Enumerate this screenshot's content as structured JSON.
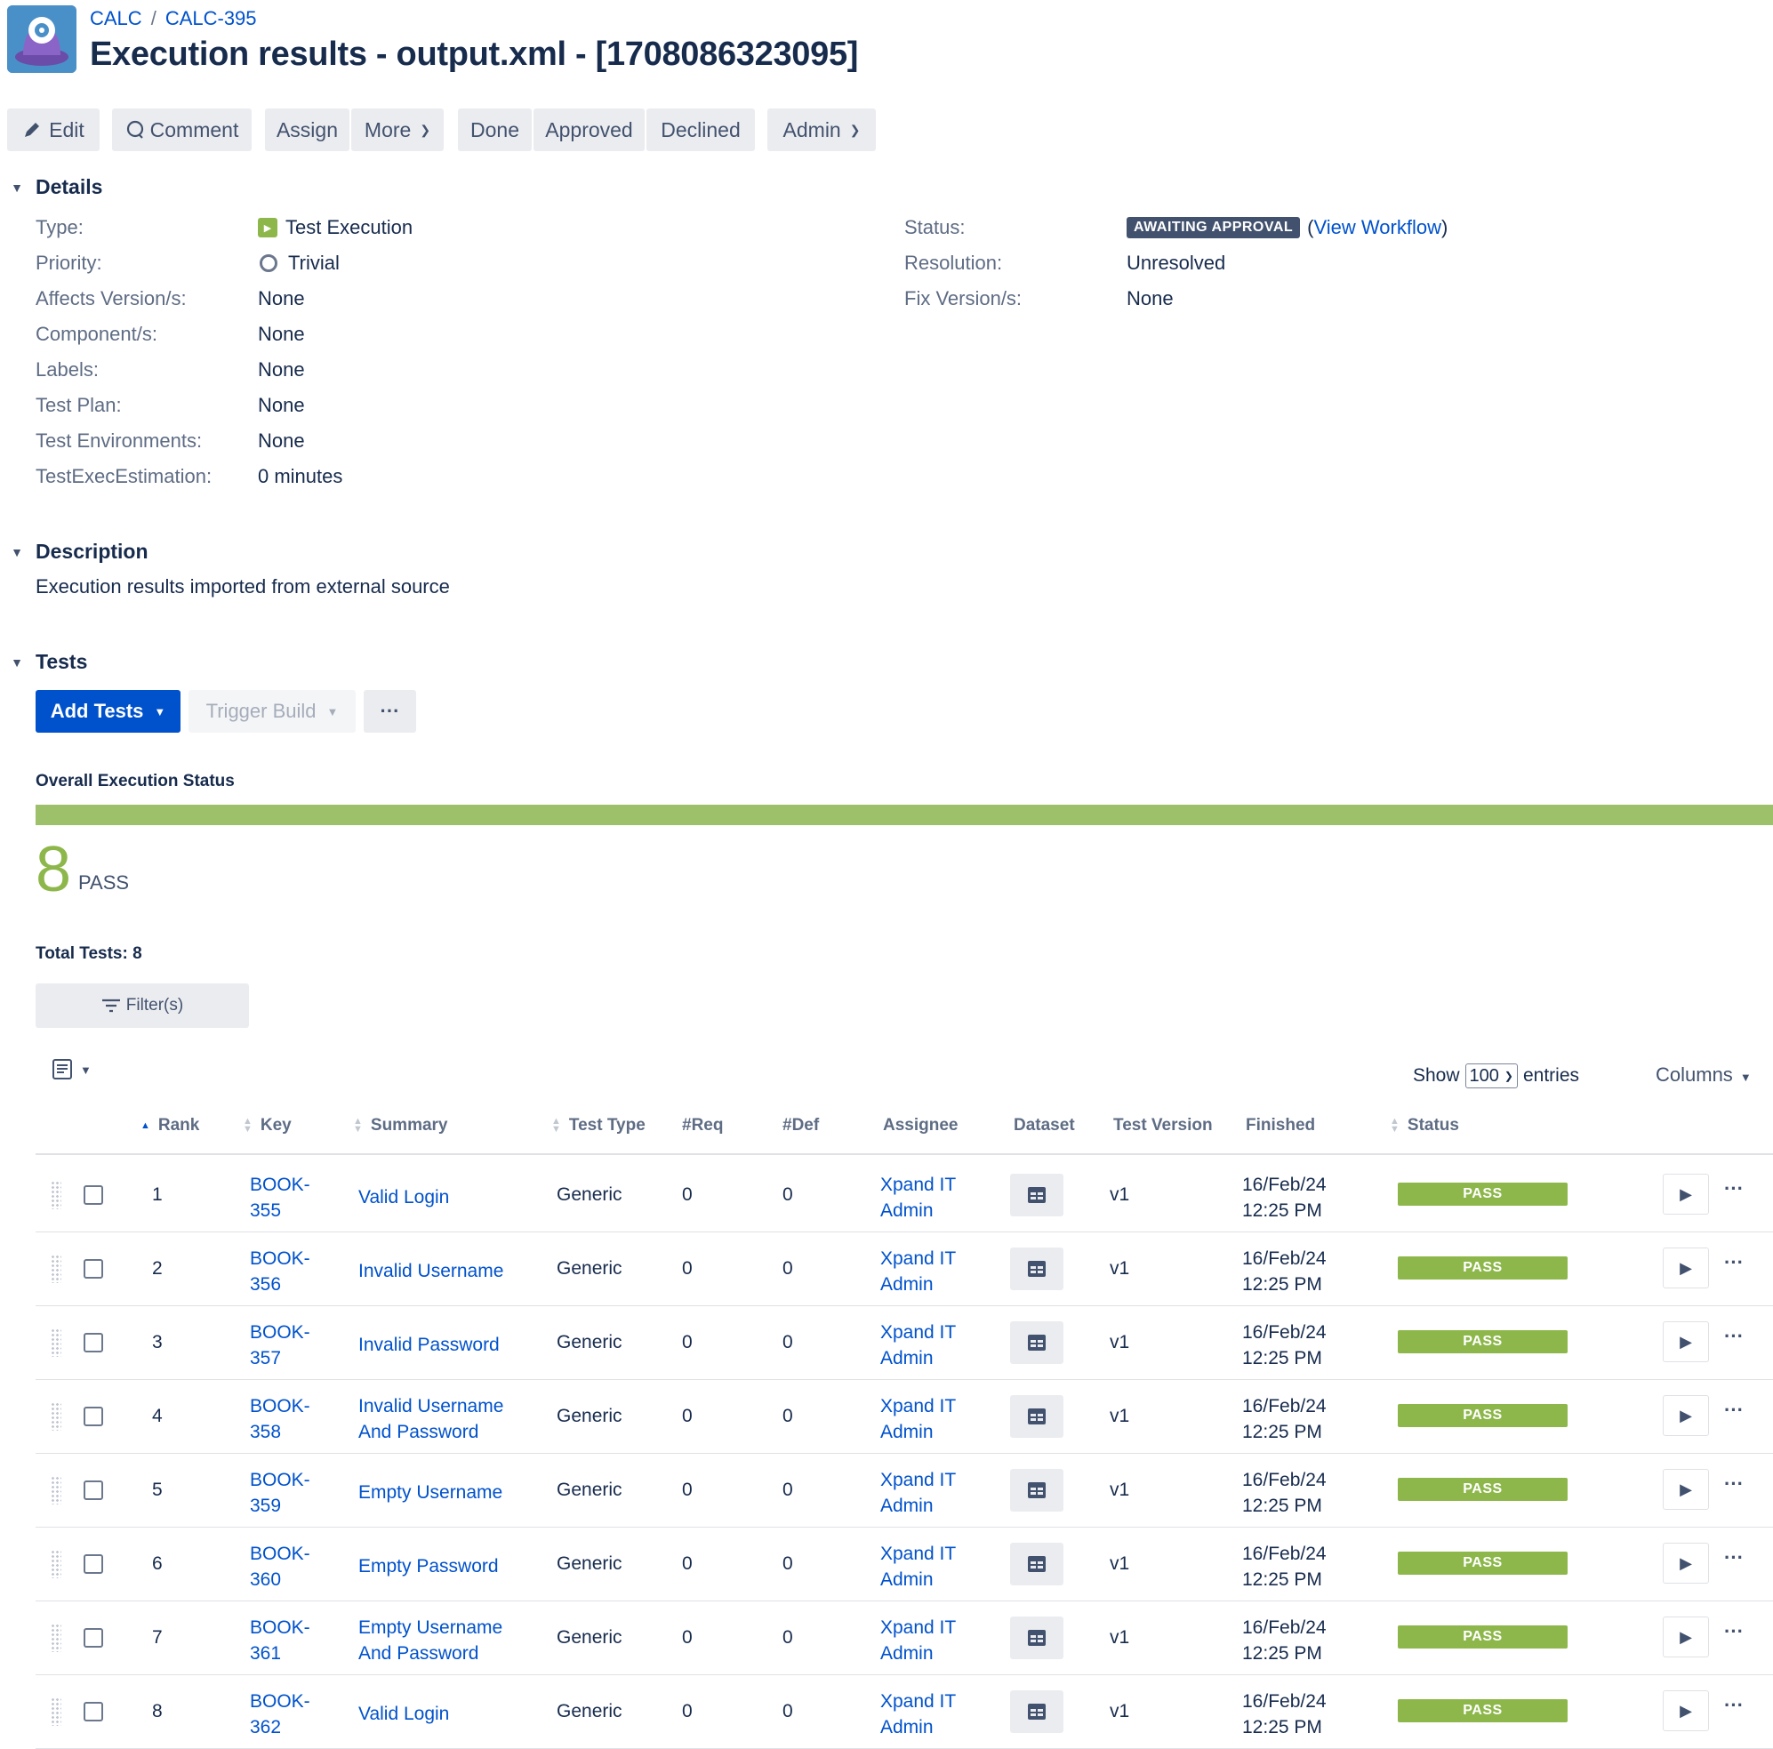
{
  "breadcrumb": {
    "project": "CALC",
    "issue_key": "CALC-395"
  },
  "title": "Execution results - output.xml - [1708086323095]",
  "toolbar": {
    "edit": "Edit",
    "comment": "Comment",
    "assign": "Assign",
    "more": "More",
    "done": "Done",
    "approved": "Approved",
    "declined": "Declined",
    "admin": "Admin"
  },
  "details": {
    "heading": "Details",
    "type_label": "Type:",
    "type_value": "Test Execution",
    "priority_label": "Priority:",
    "priority_value": "Trivial",
    "affects_label": "Affects Version/s:",
    "affects_value": "None",
    "components_label": "Component/s:",
    "components_value": "None",
    "labels_label": "Labels:",
    "labels_value": "None",
    "testplan_label": "Test Plan:",
    "testplan_value": "None",
    "testenv_label": "Test Environments:",
    "testenv_value": "None",
    "estimation_label": "TestExecEstimation:",
    "estimation_value": "0 minutes",
    "status_label": "Status:",
    "status_value": "AWAITING APPROVAL",
    "view_workflow": "View Workflow",
    "resolution_label": "Resolution:",
    "resolution_value": "Unresolved",
    "fix_label": "Fix Version/s:",
    "fix_value": "None"
  },
  "description": {
    "heading": "Description",
    "text": "Execution results imported from external source"
  },
  "tests": {
    "heading": "Tests",
    "add_tests": "Add Tests",
    "trigger_build": "Trigger Build",
    "overall_label": "Overall Execution Status",
    "pass_count": "8",
    "pass_label": "PASS",
    "pass_fraction": 1.0,
    "total_tests": "Total Tests: 8",
    "filters": "Filter(s)",
    "show": "Show",
    "show_value": "100",
    "entries": "entries",
    "columns": "Columns"
  },
  "table": {
    "headers": {
      "rank": "Rank",
      "key": "Key",
      "summary": "Summary",
      "test_type": "Test Type",
      "req": "#Req",
      "def": "#Def",
      "assignee": "Assignee",
      "dataset": "Dataset",
      "test_version": "Test Version",
      "finished": "Finished",
      "status": "Status"
    },
    "rows": [
      {
        "rank": "1",
        "key_a": "BOOK-",
        "key_b": "355",
        "sum_a": "Valid Login",
        "sum_b": "",
        "type": "Generic",
        "req": "0",
        "def": "0",
        "asg_a": "Xpand IT",
        "asg_b": "Admin",
        "ver": "v1",
        "fin_a": "16/Feb/24",
        "fin_b": "12:25 PM",
        "status": "PASS"
      },
      {
        "rank": "2",
        "key_a": "BOOK-",
        "key_b": "356",
        "sum_a": "Invalid Username",
        "sum_b": "",
        "type": "Generic",
        "req": "0",
        "def": "0",
        "asg_a": "Xpand IT",
        "asg_b": "Admin",
        "ver": "v1",
        "fin_a": "16/Feb/24",
        "fin_b": "12:25 PM",
        "status": "PASS"
      },
      {
        "rank": "3",
        "key_a": "BOOK-",
        "key_b": "357",
        "sum_a": "Invalid Password",
        "sum_b": "",
        "type": "Generic",
        "req": "0",
        "def": "0",
        "asg_a": "Xpand IT",
        "asg_b": "Admin",
        "ver": "v1",
        "fin_a": "16/Feb/24",
        "fin_b": "12:25 PM",
        "status": "PASS"
      },
      {
        "rank": "4",
        "key_a": "BOOK-",
        "key_b": "358",
        "sum_a": "Invalid Username",
        "sum_b": "And Password",
        "type": "Generic",
        "req": "0",
        "def": "0",
        "asg_a": "Xpand IT",
        "asg_b": "Admin",
        "ver": "v1",
        "fin_a": "16/Feb/24",
        "fin_b": "12:25 PM",
        "status": "PASS"
      },
      {
        "rank": "5",
        "key_a": "BOOK-",
        "key_b": "359",
        "sum_a": "Empty Username",
        "sum_b": "",
        "type": "Generic",
        "req": "0",
        "def": "0",
        "asg_a": "Xpand IT",
        "asg_b": "Admin",
        "ver": "v1",
        "fin_a": "16/Feb/24",
        "fin_b": "12:25 PM",
        "status": "PASS"
      },
      {
        "rank": "6",
        "key_a": "BOOK-",
        "key_b": "360",
        "sum_a": "Empty Password",
        "sum_b": "",
        "type": "Generic",
        "req": "0",
        "def": "0",
        "asg_a": "Xpand IT",
        "asg_b": "Admin",
        "ver": "v1",
        "fin_a": "16/Feb/24",
        "fin_b": "12:25 PM",
        "status": "PASS"
      },
      {
        "rank": "7",
        "key_a": "BOOK-",
        "key_b": "361",
        "sum_a": "Empty Username",
        "sum_b": "And Password",
        "type": "Generic",
        "req": "0",
        "def": "0",
        "asg_a": "Xpand IT",
        "asg_b": "Admin",
        "ver": "v1",
        "fin_a": "16/Feb/24",
        "fin_b": "12:25 PM",
        "status": "PASS"
      },
      {
        "rank": "8",
        "key_a": "BOOK-",
        "key_b": "362",
        "sum_a": "Valid Login",
        "sum_b": "",
        "type": "Generic",
        "req": "0",
        "def": "0",
        "asg_a": "Xpand IT",
        "asg_b": "Admin",
        "ver": "v1",
        "fin_a": "16/Feb/24",
        "fin_b": "12:25 PM",
        "status": "PASS"
      }
    ]
  },
  "colors": {
    "accent": "#0052cc",
    "pass": "#8db74b",
    "status_lozenge": "#42526e"
  },
  "icons": [
    "project-avatar-icon",
    "pencil-icon",
    "comment-icon",
    "chevron-down-icon",
    "test-execution-icon",
    "trivial-priority-icon",
    "filter-icon",
    "column-list-icon",
    "drag-handle-icon",
    "dataset-icon",
    "play-icon",
    "more-icon"
  ]
}
